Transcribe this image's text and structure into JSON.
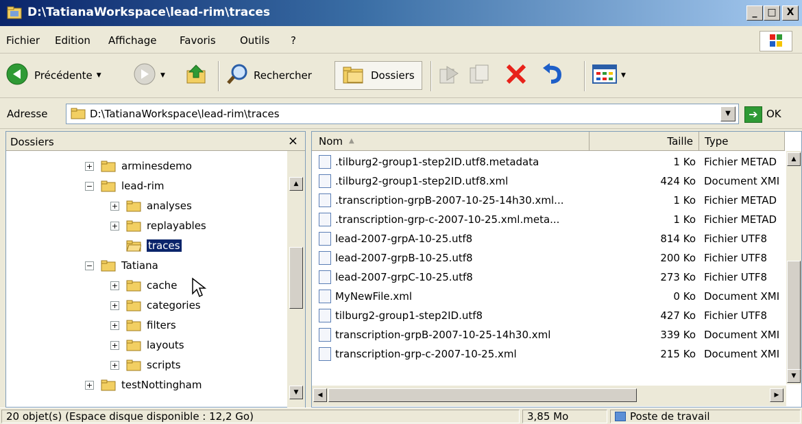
{
  "window": {
    "title": "D:\\TatianaWorkspace\\lead-rim\\traces",
    "minimize": "_",
    "maximize": "□",
    "close": "X"
  },
  "menu": [
    "Fichier",
    "Edition",
    "Affichage",
    "Favoris",
    "Outils",
    "?"
  ],
  "toolbar": {
    "back_label": "Précédente",
    "search_label": "Rechercher",
    "folders_label": "Dossiers"
  },
  "address": {
    "label": "Adresse",
    "value": "D:\\TatianaWorkspace\\lead-rim\\traces",
    "go_label": "OK"
  },
  "folders_pane": {
    "title": "Dossiers",
    "close": "×",
    "nodes": [
      {
        "label": "arminesdemo",
        "expander": "+"
      },
      {
        "label": "lead-rim",
        "expander": "−"
      },
      {
        "label": "analyses",
        "expander": "+"
      },
      {
        "label": "replayables",
        "expander": "+"
      },
      {
        "label": "traces",
        "expander": "",
        "selected": true
      },
      {
        "label": "Tatiana",
        "expander": "−"
      },
      {
        "label": "cache",
        "expander": "+"
      },
      {
        "label": "categories",
        "expander": "+"
      },
      {
        "label": "filters",
        "expander": "+"
      },
      {
        "label": "layouts",
        "expander": "+"
      },
      {
        "label": "scripts",
        "expander": "+"
      },
      {
        "label": "testNottingham",
        "expander": "+"
      }
    ]
  },
  "files": {
    "columns": {
      "name": "Nom",
      "size": "Taille",
      "type": "Type"
    },
    "rows": [
      {
        "name": ".tilburg2-group1-step2ID.utf8.metadata",
        "size": "1 Ko",
        "type": "Fichier METAD",
        "icon": "metadata-file-icon"
      },
      {
        "name": ".tilburg2-group1-step2ID.utf8.xml",
        "size": "424 Ko",
        "type": "Document XMI",
        "icon": "xml-file-icon"
      },
      {
        "name": ".transcription-grpB-2007-10-25-14h30.xml...",
        "size": "1 Ko",
        "type": "Fichier METAD",
        "icon": "metadata-file-icon"
      },
      {
        "name": ".transcription-grp-c-2007-10-25.xml.meta...",
        "size": "1 Ko",
        "type": "Fichier METAD",
        "icon": "metadata-file-icon"
      },
      {
        "name": "lead-2007-grpA-10-25.utf8",
        "size": "814 Ko",
        "type": "Fichier UTF8",
        "icon": "utf8-file-icon"
      },
      {
        "name": "lead-2007-grpB-10-25.utf8",
        "size": "200 Ko",
        "type": "Fichier UTF8",
        "icon": "utf8-file-icon"
      },
      {
        "name": "lead-2007-grpC-10-25.utf8",
        "size": "273 Ko",
        "type": "Fichier UTF8",
        "icon": "utf8-file-icon"
      },
      {
        "name": "MyNewFile.xml",
        "size": "0 Ko",
        "type": "Document XMI",
        "icon": "xml-file-icon"
      },
      {
        "name": "tilburg2-group1-step2ID.utf8",
        "size": "427 Ko",
        "type": "Fichier UTF8",
        "icon": "utf8-file-icon"
      },
      {
        "name": "transcription-grpB-2007-10-25-14h30.xml",
        "size": "339 Ko",
        "type": "Document XMI",
        "icon": "xml-file-icon"
      },
      {
        "name": "transcription-grp-c-2007-10-25.xml",
        "size": "215 Ko",
        "type": "Document XMI",
        "icon": "xml-file-icon"
      }
    ]
  },
  "status": {
    "objects": "20 objet(s) (Espace disque disponible : 12,2 Go)",
    "size": "3,85 Mo",
    "location": "Poste de travail"
  },
  "colors": {
    "title_gradient_start": "#0a246a",
    "selection": "#0a246a",
    "chrome": "#ece9d8",
    "folder_yellow": "#f2cf62",
    "delete_red": "#e8221a",
    "go_green": "#2f9a35"
  }
}
